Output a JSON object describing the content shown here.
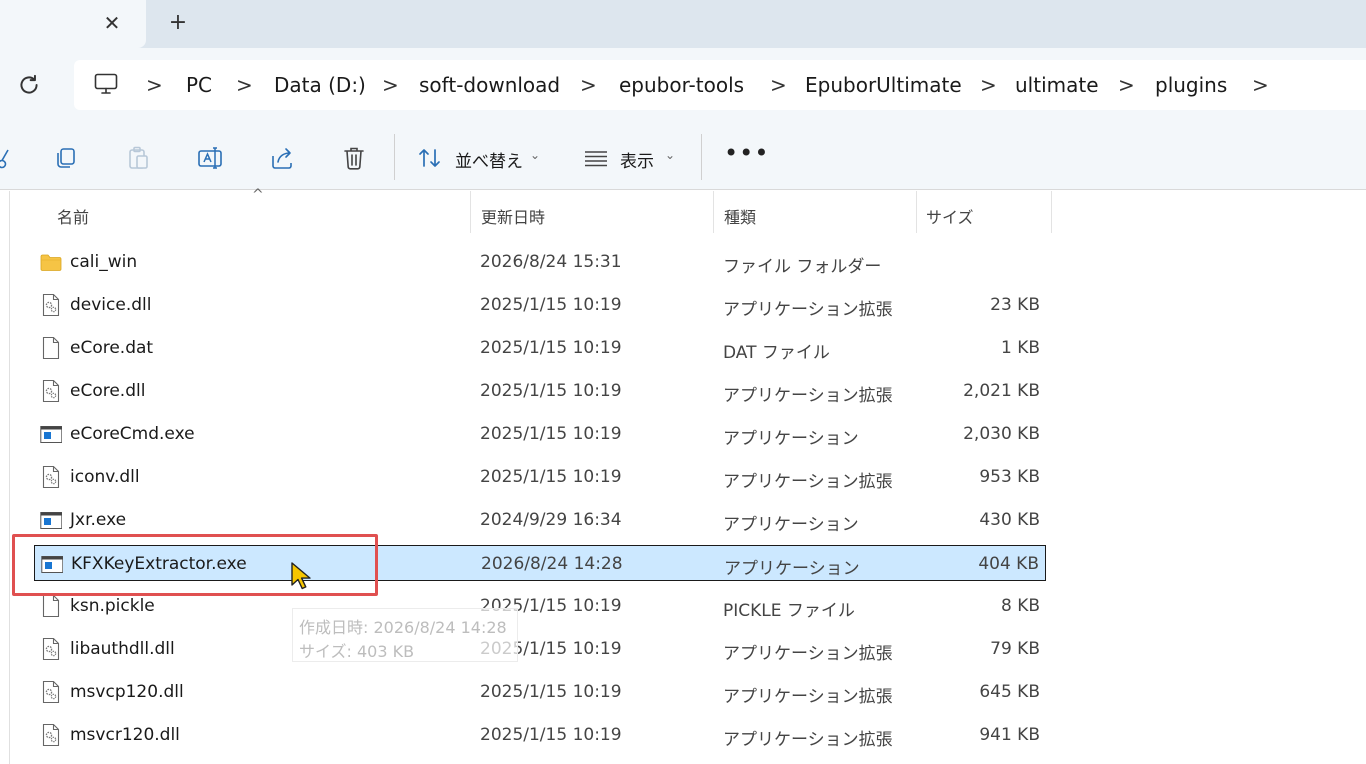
{
  "tabbar": {
    "close_glyph": "✕",
    "new_tab_glyph": "+"
  },
  "address": {
    "separator": ">",
    "crumbs": [
      "PC",
      "Data (D:)",
      "soft-download",
      "epubor-tools",
      "EpuborUltimate",
      "ultimate",
      "plugins"
    ]
  },
  "toolbar": {
    "sort_label": "並べ替え",
    "view_label": "表示",
    "more_label": "•••",
    "chevron": "⌄"
  },
  "columns": {
    "name": "名前",
    "date": "更新日時",
    "type": "種類",
    "size": "サイズ",
    "sort_glyph": "^"
  },
  "files": [
    {
      "name": "cali_win",
      "date": "2026/8/24 15:31",
      "type": "ファイル フォルダー",
      "size": "",
      "icon": "folder-icon"
    },
    {
      "name": "device.dll",
      "date": "2025/1/15 10:19",
      "type": "アプリケーション拡張",
      "size": "23 KB",
      "icon": "dll-file-icon"
    },
    {
      "name": "eCore.dat",
      "date": "2025/1/15 10:19",
      "type": "DAT ファイル",
      "size": "1 KB",
      "icon": "blank-file-icon"
    },
    {
      "name": "eCore.dll",
      "date": "2025/1/15 10:19",
      "type": "アプリケーション拡張",
      "size": "2,021 KB",
      "icon": "dll-file-icon"
    },
    {
      "name": "eCoreCmd.exe",
      "date": "2025/1/15 10:19",
      "type": "アプリケーション",
      "size": "2,030 KB",
      "icon": "exe-file-icon"
    },
    {
      "name": "iconv.dll",
      "date": "2025/1/15 10:19",
      "type": "アプリケーション拡張",
      "size": "953 KB",
      "icon": "dll-file-icon"
    },
    {
      "name": "Jxr.exe",
      "date": "2024/9/29 16:34",
      "type": "アプリケーション",
      "size": "430 KB",
      "icon": "exe-file-icon"
    },
    {
      "name": "KFXKeyExtractor.exe",
      "date": "2026/8/24 14:28",
      "type": "アプリケーション",
      "size": "404 KB",
      "icon": "exe-file-icon",
      "selected": true
    },
    {
      "name": "ksn.pickle",
      "date": "2025/1/15 10:19",
      "type": "PICKLE ファイル",
      "size": "8 KB",
      "icon": "blank-file-icon"
    },
    {
      "name": "libauthdll.dll",
      "date": "2025/1/15 10:19",
      "type": "アプリケーション拡張",
      "size": "79 KB",
      "icon": "dll-file-icon"
    },
    {
      "name": "msvcp120.dll",
      "date": "2025/1/15 10:19",
      "type": "アプリケーション拡張",
      "size": "645 KB",
      "icon": "dll-file-icon"
    },
    {
      "name": "msvcr120.dll",
      "date": "2025/1/15 10:19",
      "type": "アプリケーション拡張",
      "size": "941 KB",
      "icon": "dll-file-icon"
    }
  ],
  "tooltip": {
    "created": "作成日時: 2026/8/24 14:28",
    "size": "サイズ: 403 KB"
  },
  "colors": {
    "selection": "#cce8ff",
    "highlight": "#e05050",
    "chrome": "#f3f7fa",
    "tabstrip": "#dde6ee"
  }
}
